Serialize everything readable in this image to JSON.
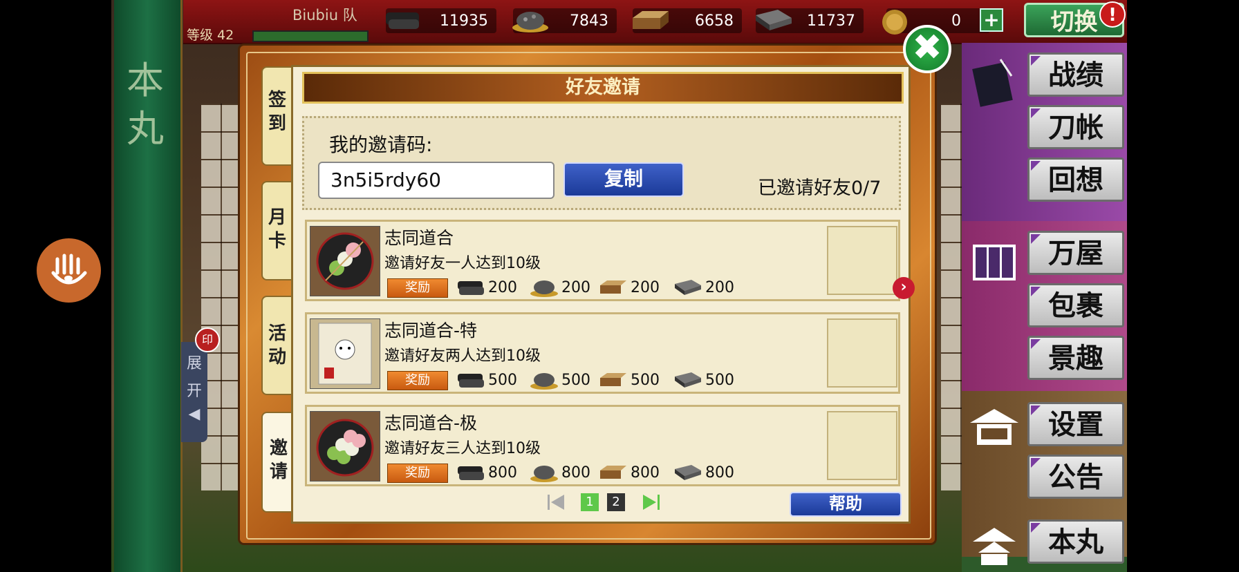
{
  "header": {
    "level_label": "等级 42",
    "player_name": "Biubiu 队",
    "resources": [
      {
        "icon": "charcoal-icon",
        "value": "11935"
      },
      {
        "icon": "whetstone-icon",
        "value": "7843"
      },
      {
        "icon": "cedar-wood-icon",
        "value": "6658"
      },
      {
        "icon": "steel-ingot-icon",
        "value": "11737"
      }
    ],
    "coin": {
      "icon": "koban-coin-icon",
      "value": "0"
    },
    "plus_label": "+",
    "switch_label": "切换",
    "alert_label": "!"
  },
  "left_banner": {
    "text": "本丸",
    "expand_label": "展开",
    "expand_arrow": "◀",
    "badge_label": "印"
  },
  "right_menu": {
    "items": [
      {
        "label": "战绩"
      },
      {
        "label": "刀帐"
      },
      {
        "label": "回想"
      },
      {
        "label": "万屋"
      },
      {
        "label": "包裹"
      },
      {
        "label": "景趣"
      },
      {
        "label": "设置"
      },
      {
        "label": "公告"
      },
      {
        "label": "本丸"
      }
    ]
  },
  "dialog": {
    "close_label": "✖",
    "tabs": [
      {
        "label": "签到"
      },
      {
        "label": "月卡"
      },
      {
        "label": "活动"
      },
      {
        "label": "邀请"
      }
    ],
    "title": "好友邀请",
    "invite_code_label": "我的邀请码:",
    "invite_code": "3n5i5rdy60",
    "copy_label": "复制",
    "invited_count": "已邀请好友0/7",
    "reward_label": "奖励",
    "quests": [
      {
        "title": "志同道合",
        "description": "邀请好友一人达到10级",
        "rewards": [
          "200",
          "200",
          "200",
          "200"
        ]
      },
      {
        "title": "志同道合-特",
        "description": "邀请好友两人达到10级",
        "rewards": [
          "500",
          "500",
          "500",
          "500"
        ]
      },
      {
        "title": "志同道合-极",
        "description": "邀请好友三人达到10级",
        "rewards": [
          "800",
          "800",
          "800",
          "800"
        ]
      }
    ],
    "next_arrow": "›",
    "pager": {
      "pages": [
        "1",
        "2"
      ],
      "current": 1
    },
    "help_label": "帮助"
  },
  "colors": {
    "accent_red": "#8e1414",
    "panel_bg": "#f5eed6",
    "button_blue": "#1b3a98",
    "green": "#1d7045"
  }
}
